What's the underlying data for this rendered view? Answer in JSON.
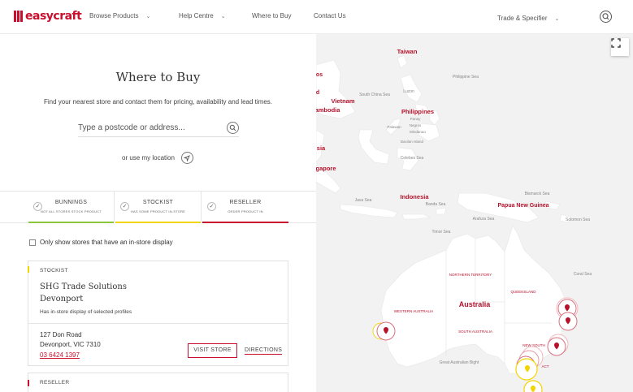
{
  "header": {
    "brand": "easycraft",
    "nav": [
      {
        "label": "Browse Products",
        "has_menu": true
      },
      {
        "label": "Help Centre",
        "has_menu": true
      },
      {
        "label": "Where to Buy",
        "has_menu": false
      },
      {
        "label": "Contact Us",
        "has_menu": false
      }
    ],
    "trade": {
      "label": "Trade & Specifier",
      "has_menu": true
    },
    "icons": {
      "search": "search-icon",
      "chevron": "chevron-down-icon"
    }
  },
  "page": {
    "title": "Where to Buy",
    "subtitle": "Find your nearest store and contact them for pricing, availability and lead times.",
    "search_placeholder": "Type a postcode or address...",
    "use_location": "or use my location"
  },
  "legend": [
    {
      "title": "BUNNINGS",
      "sub": "NOT ALL STORES STOCK PRODUCT",
      "color": "#8cc63f"
    },
    {
      "title": "STOCKIST",
      "sub": "HAS SOME PRODUCT IN-STORE",
      "color": "#f2d500"
    },
    {
      "title": "RESELLER",
      "sub": "ORDER PRODUCT IN",
      "color": "#c8102e"
    }
  ],
  "filter": {
    "label": "Only show stores that have an in-store display",
    "checked": false
  },
  "stores": [
    {
      "type": "STOCKIST",
      "name": "SHG Trade Solutions",
      "location": "Devonport",
      "note": "Has in-store display of selected profiles",
      "address1": "127 Don Road",
      "address2": "Devonport, VIC 7310",
      "phone": "03 6424 1397",
      "visit_label": "VISIT STORE",
      "directions_label": "DIRECTIONS",
      "accent": "#f2d500"
    },
    {
      "type": "RESELLER",
      "accent": "#c8102e"
    }
  ],
  "map": {
    "labels": {
      "taiwan": "Taiwan",
      "philippine_sea": "Philippine Sea",
      "vietnam": "Vietnam",
      "south_china_sea": "South China Sea",
      "luzon": "Luzon",
      "philippines": "Philippines",
      "cambodia": "ambodia",
      "panay": "Panay",
      "negros": "Negros",
      "palawan": "Palawan",
      "mindanao": "Mindanao",
      "basilan": "Basilan Island",
      "celebes": "Celebes Sea",
      "sia": "sia",
      "gapore": "gapore",
      "java_sea": "Java Sea",
      "indonesia": "Indonesia",
      "banda_sea": "Banda Sea",
      "bismarck": "Bismarck Sea",
      "png": "Papua New Guinea",
      "arafura": "Arafura Sea",
      "solomon": "Solomon Sea",
      "timor": "Timor Sea",
      "northern_territory": "NORTHERN TERRITORY",
      "coral_sea": "Coral Sea",
      "queensland": "QUEENSLAND",
      "australia": "Australia",
      "western_australia": "WESTERN AUSTRALIA",
      "south_australia": "SOUTH AUSTRALIA",
      "new_south": "NEW SOUTH",
      "great_bight": "Great Australian Bight",
      "act": "ACT",
      "s_top": "os",
      "d_left": "d"
    },
    "fullscreen_icon": "fullscreen-icon",
    "marker_icon": "map-pin-icon"
  }
}
